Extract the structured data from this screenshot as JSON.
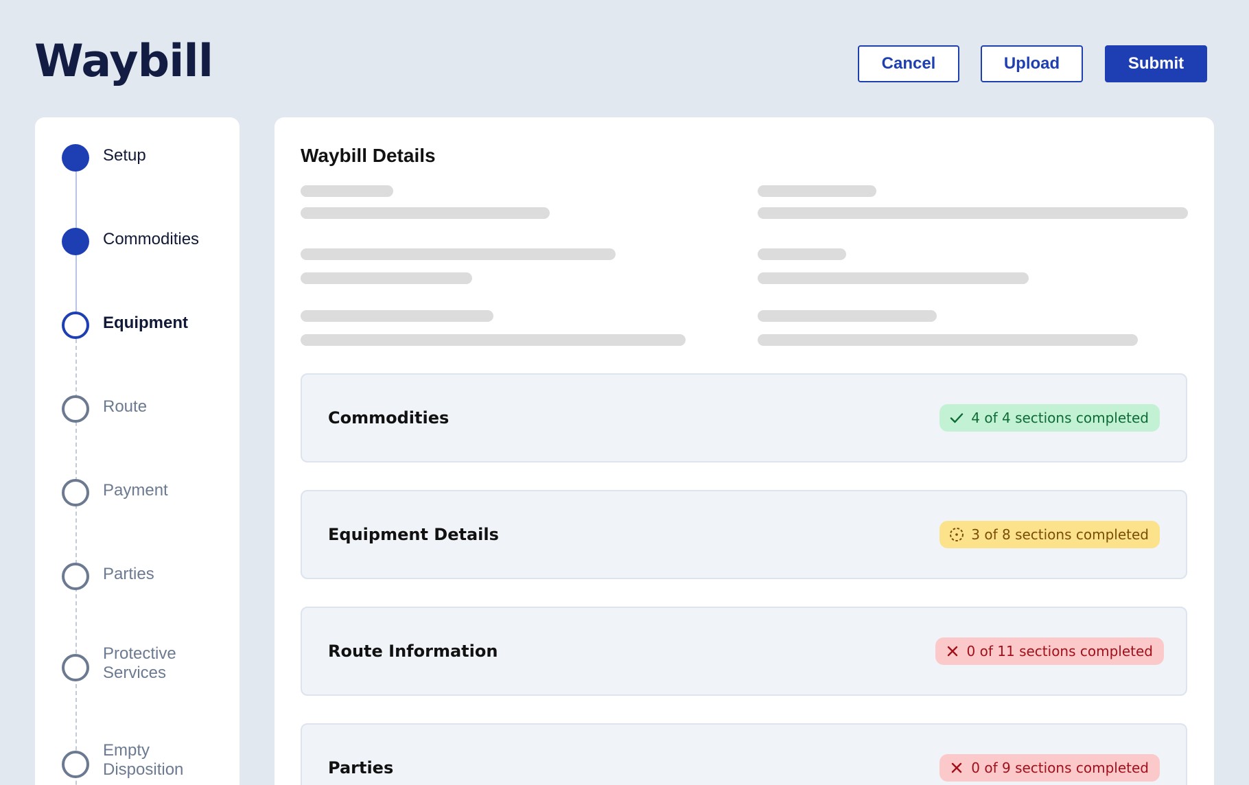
{
  "header": {
    "title": "Waybill",
    "cancel_label": "Cancel",
    "upload_label": "Upload",
    "submit_label": "Submit"
  },
  "stepper": {
    "steps": [
      {
        "label": "Setup",
        "status": "completed"
      },
      {
        "label": "Commodities",
        "status": "completed"
      },
      {
        "label": "Equipment",
        "status": "current"
      },
      {
        "label": "Route",
        "status": "upcoming"
      },
      {
        "label": "Payment",
        "status": "upcoming"
      },
      {
        "label": "Parties",
        "status": "upcoming"
      },
      {
        "label": "Protective Services",
        "status": "upcoming"
      },
      {
        "label": "Empty Disposition",
        "status": "upcoming"
      }
    ]
  },
  "main": {
    "title": "Waybill Details",
    "cards": [
      {
        "title": "Commodities",
        "status_text": "4 of 4 sections completed",
        "status": "complete",
        "icon": "check-icon"
      },
      {
        "title": "Equipment Details",
        "status_text": "3 of 8 sections completed",
        "status": "in-progress",
        "icon": "dashed-circle-icon"
      },
      {
        "title": "Route Information",
        "status_text": "0 of 11 sections completed",
        "status": "incomplete",
        "icon": "x-icon"
      },
      {
        "title": "Parties",
        "status_text": "0 of 9 sections completed",
        "status": "incomplete",
        "icon": "x-icon"
      }
    ]
  },
  "colors": {
    "background": "#e1e8f0",
    "accent": "#1e3fb4",
    "success_bg": "#c2f2d3",
    "warning_bg": "#fbe28b",
    "error_bg": "#fbc9c9"
  }
}
